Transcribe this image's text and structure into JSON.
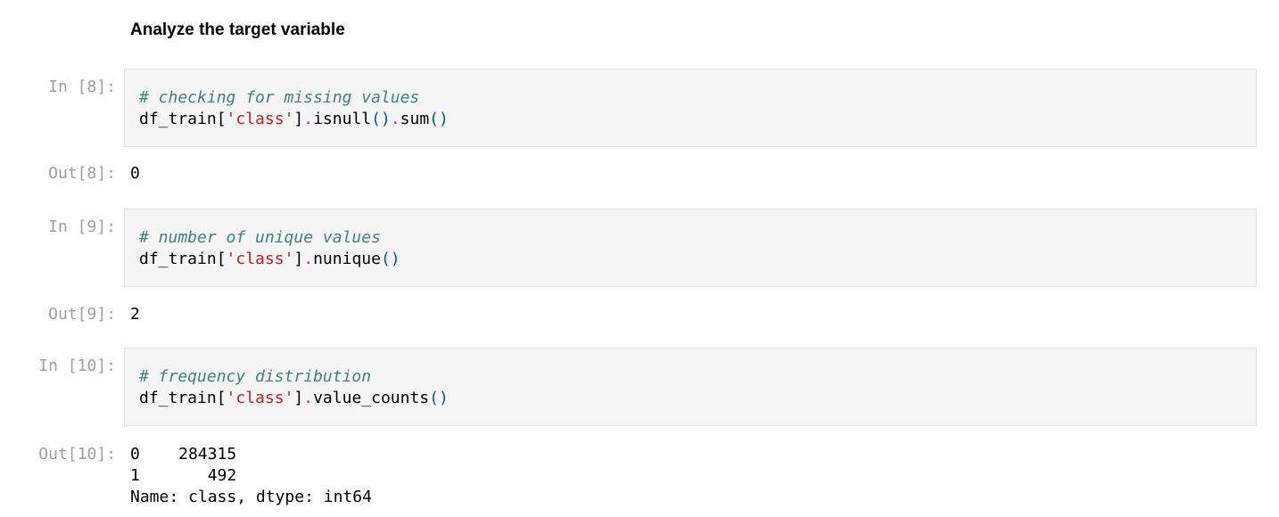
{
  "heading": "Analyze the target variable",
  "cells": [
    {
      "in_prompt": "In [8]:",
      "comment": "# checking for missing values",
      "code": {
        "obj": "df_train[",
        "str": "'class'",
        "close": "]",
        "dot1": ".",
        "m1": "isnull",
        "p1": "()",
        "dot2": ".",
        "m2": "sum",
        "p2": "()"
      },
      "out_prompt": "Out[8]:",
      "output": "0"
    },
    {
      "in_prompt": "In [9]:",
      "comment": "# number of unique values",
      "code": {
        "obj": "df_train[",
        "str": "'class'",
        "close": "]",
        "dot1": ".",
        "m1": "nunique",
        "p1": "()"
      },
      "out_prompt": "Out[9]:",
      "output": "2"
    },
    {
      "in_prompt": "In [10]:",
      "comment": "# frequency distribution",
      "code": {
        "obj": "df_train[",
        "str": "'class'",
        "close": "]",
        "dot1": ".",
        "m1": "value_counts",
        "p1": "()"
      },
      "out_prompt": "Out[10]:",
      "output_lines": [
        "0    284315",
        "1       492",
        "Name: class, dtype: int64"
      ]
    }
  ]
}
